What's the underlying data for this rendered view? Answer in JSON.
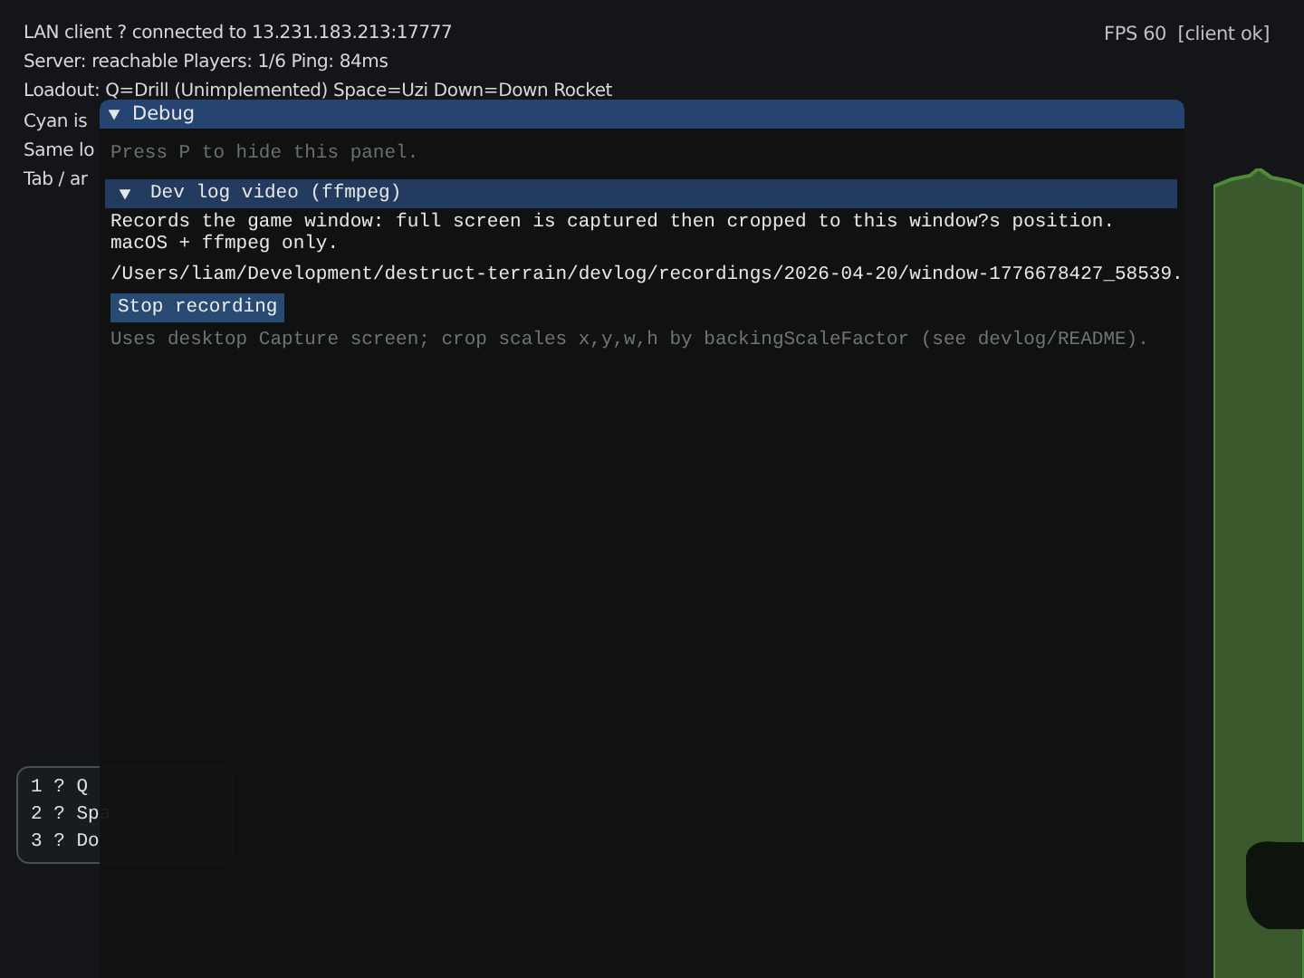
{
  "hud": {
    "lines": [
      "LAN client ? connected to 13.231.183.213:17777",
      "Server: reachable  Players: 1/6  Ping: 84ms",
      "Loadout: Q=Drill (Unimplemented)  Space=Uzi  Down=Down Rocket",
      "Cyan is",
      "Same lo",
      "Tab / ar"
    ],
    "status": "FPS 60  [client ok]"
  },
  "hotbar": {
    "items": [
      "1 ? Q",
      "2 ? Spa",
      "3 ? Do"
    ]
  },
  "debug_panel": {
    "title": "Debug",
    "expanded": true,
    "hint": "Press P to hide this panel.",
    "section": {
      "title": "Dev log video (ffmpeg)",
      "expanded": true,
      "lines": [
        "Records the game window: full screen is captured then cropped to this window?s position.",
        "macOS + ffmpeg only."
      ],
      "path": "/Users/liam/Development/destruct-terrain/devlog/recordings/2026-04-20/window-1776678427_58539.",
      "button": "Stop recording",
      "note": "Uses desktop Capture screen; crop scales x,y,w,h by backingScaleFactor (see devlog/README)."
    }
  }
}
